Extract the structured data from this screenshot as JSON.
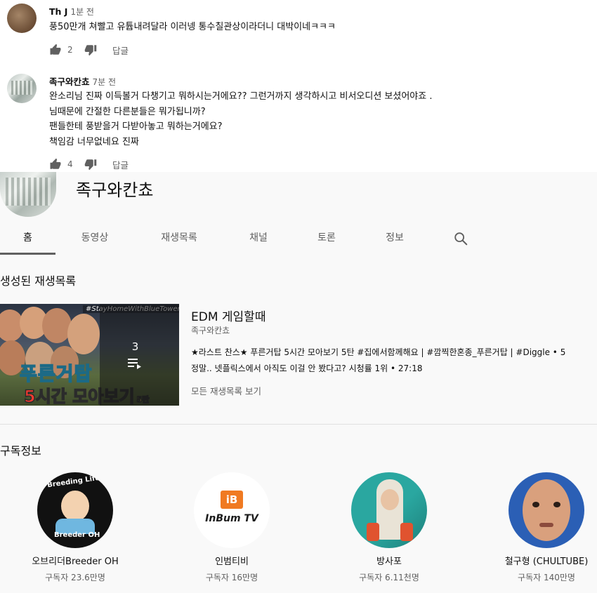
{
  "comments": [
    {
      "author": "Th J",
      "time": "1분 전",
      "lines": [
        "풍50만개 쳐빨고 유튭내려달라 이러넹 통수칠관상이라더니 대박이네ㅋㅋㅋ"
      ],
      "likes": "2",
      "reply_label": "답글"
    },
    {
      "author": "족구와칸쵸",
      "time": "7분 전",
      "lines": [
        "완소리님 진짜 이득볼거 다챙기고 뭐하시는거에요??  그런거까지 생각하시고 비서오디션 보셨어야죠 .",
        "님때문에 간절한 다른분들은 뭐가됩니까?",
        "팬들한테 풍받을거 다받아놓고 뭐하는거에요?",
        "책임감 너무없네요 진짜"
      ],
      "likes": "4",
      "reply_label": "답글"
    }
  ],
  "channel": {
    "name": "족구와칸쵸",
    "tabs": [
      "홈",
      "동영상",
      "재생목록",
      "채널",
      "토론",
      "정보"
    ],
    "active_tab": "홈"
  },
  "sections": {
    "playlists_title": "생성된 재생목록",
    "subscriptions_title": "구독정보"
  },
  "playlist": {
    "title": "EDM 게임할때",
    "channel": "족구와칸쵸",
    "video_count": "3",
    "thumb_tag": "#StayHomeWithBlueTower",
    "thumb_line1": "푸른거탑",
    "thumb_line2_red": "5시간",
    "thumb_line2_rest": " 모아보기",
    "thumb_line2_small": "5탄",
    "videos": [
      "★라스트 찬스★ 푸른거탑 5시간 모아보기 5탄 #집에서함께해요 | #깜찍한혼종_푸른거탑 | #Diggle • 5",
      "정말.. 넷플릭스에서 아직도 이걸 안 봤다고? 시청률 1위 • 27:18"
    ],
    "view_all": "모든 재생목록 보기"
  },
  "subscriptions": [
    {
      "name": "오브리더Breeder OH",
      "count": "구독자 23.6만명",
      "logo_top": "Breeding Life",
      "logo_bottom": "Breeder OH"
    },
    {
      "name": "인범티비",
      "count": "구독자 16만명",
      "logo_mark": "iB",
      "logo_text": "InBum TV"
    },
    {
      "name": "방사포",
      "count": "구독자 6.11천명"
    },
    {
      "name": "철구형 (CHULTUBE)",
      "count": "구독자 140만명"
    }
  ],
  "colors": {
    "text_primary": "#0f0f0f",
    "text_secondary": "#606060",
    "page_bg": "#f9f9f9",
    "divider": "#e0e0e0",
    "inbum_orange": "#f07a22"
  }
}
